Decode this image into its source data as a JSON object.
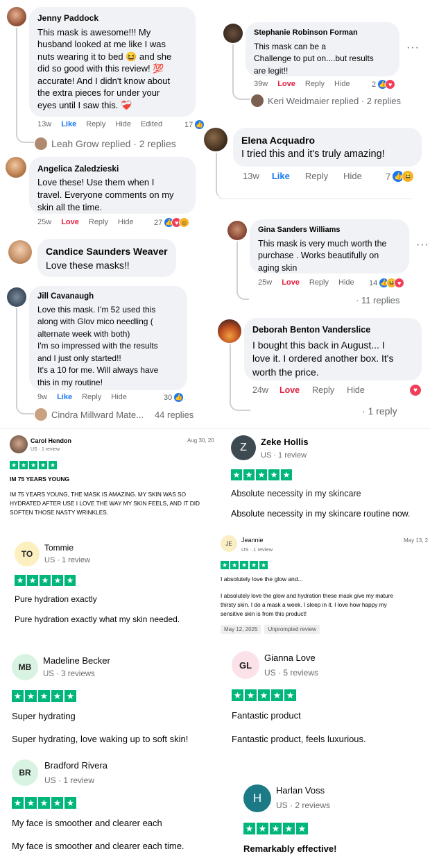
{
  "fb": {
    "c1": {
      "name": "Jenny Paddock",
      "l1": "This mask is awesome!!! My",
      "l2": "husband looked at me like I was",
      "l3": "nuts wearing it to bed 😆 and she",
      "l4": "did so good with this review! 💯",
      "l5": "accurate! And I didn't know about",
      "l6": "the extra pieces for under your",
      "l7": "eyes until I saw this. ❤️‍🩹",
      "time": "13w",
      "react": "Like",
      "reply": "Reply",
      "hide": "Hide",
      "edited": "Edited",
      "count": "17",
      "replies": "Leah Grow replied · 2 replies"
    },
    "c2": {
      "name": "Stephanie Robinson Forman",
      "l1": "This mask can be a",
      "l2": "Challenge to put on....but results",
      "l3": "are legit!!",
      "time": "39w",
      "react": "Love",
      "reply": "Reply",
      "hide": "Hide",
      "count": "2",
      "replies": "Keri Weidmaier replied · 2 replies",
      "more": "···"
    },
    "c3": {
      "name": "Elena Acquadro",
      "l1": "I tried this and it's truly amazing!",
      "time": "13w",
      "react": "Like",
      "reply": "Reply",
      "hide": "Hide",
      "count": "7"
    },
    "c4": {
      "name": "Angelica Zaledzieski",
      "l1": "Love these! Use them when I",
      "l2": "travel. Everyone comments on my",
      "l3": "skin all the time.",
      "time": "25w",
      "react": "Love",
      "reply": "Reply",
      "hide": "Hide",
      "count": "27"
    },
    "c5": {
      "name": "Gina Sanders Williams",
      "l1": "This mask is very much worth the",
      "l2": "purchase . Works beautifully on",
      "l3": "aging skin",
      "time": "25w",
      "react": "Love",
      "reply": "Reply",
      "hide": "Hide",
      "count": "14",
      "replies": "· 11 replies",
      "more": "···"
    },
    "c6": {
      "name": "Candice Saunders Weaver",
      "l1": "Love these masks!!"
    },
    "c7": {
      "name": "Jill Cavanaugh",
      "l1": "Love this mask. I'm 52 used this",
      "l2": "along with Glov mico needling (",
      "l3": "alternate week with both)",
      "l4": "I'm so impressed with the results",
      "l5": "and I just only started!!",
      "l6": "It's a 10 for me. Will always have",
      "l7": "this in my routine!",
      "time": "9w",
      "react": "Like",
      "reply": "Reply",
      "hide": "Hide",
      "count": "30",
      "replier": "Cindra Millward Mate...",
      "replies": "44 replies"
    },
    "c8": {
      "name": "Deborah Benton Vanderslice",
      "l1": "I bought this back in August... I",
      "l2": "love it. I ordered another box. It's",
      "l3": "worth the price.",
      "time": "24w",
      "react": "Love",
      "reply": "Reply",
      "hide": "Hide",
      "replies": "· 1 reply"
    }
  },
  "tp": {
    "carol": {
      "name": "Carol Hendon",
      "meta": "US · 1 review",
      "date": "Aug 30, 20",
      "title": "IM 75 YEARS YOUNG",
      "b1": "IM 75 YEARS YOUNG, THE MASK IS AMAZING. MY SKIN WAS SO",
      "b2": "HYDRATED AFTER USE I LOVE THE WAY MY SKIN FEELS, AND IT DID",
      "b3": "SOFTEN THOSE NASTY WRINKLES.",
      "rating": 5
    },
    "zeke": {
      "initials": "Z",
      "name": "Zeke Hollis",
      "meta": "US · 1 review",
      "title": "Absolute necessity in my skincare",
      "body": "Absolute necessity in my skincare routine now.",
      "rating": 5
    },
    "tommie": {
      "initials": "TO",
      "name": "Tommie",
      "meta": "US · 1 review",
      "title": "Pure hydration exactly",
      "body": "Pure hydration exactly what my skin needed.",
      "rating": 5
    },
    "jeannie": {
      "initials": "JE",
      "name": "Jeannie",
      "meta": "US · 1 review",
      "date": "May 13, 2",
      "title": "I absolutely love the glow and...",
      "b1": "I absolutely love the glow and hydration these mask give my mature",
      "b2": "thirsty skin. I do a mask a week. I sleep in it. I love how happy my",
      "b3": "sensitive skin is from this product!",
      "tag1": "May 12, 2025",
      "tag2": "Unprompted review",
      "rating": 5
    },
    "madeline": {
      "initials": "MB",
      "name": "Madeline Becker",
      "meta": "US · 3 reviews",
      "title": "Super hydrating",
      "body": "Super hydrating, love waking up to soft skin!",
      "rating": 5
    },
    "gianna": {
      "initials": "GL",
      "name": "Gianna Love",
      "meta": "US · 5 reviews",
      "title": "Fantastic product",
      "body": "Fantastic product, feels luxurious.",
      "rating": 5
    },
    "bradford": {
      "initials": "BR",
      "name": "Bradford Rivera",
      "meta": "US · 1 review",
      "title": "My face is smoother and clearer each",
      "body": "My face is smoother and clearer each time.",
      "rating": 5
    },
    "harlan": {
      "initials": "H",
      "name": "Harlan Voss",
      "meta": "US · 2 reviews",
      "title": "Remarkably effective!",
      "rating": 5
    }
  },
  "colors": {
    "fb_blue": "#1877f2",
    "love_red": "#e41e3f",
    "tp_green": "#00b67a"
  }
}
